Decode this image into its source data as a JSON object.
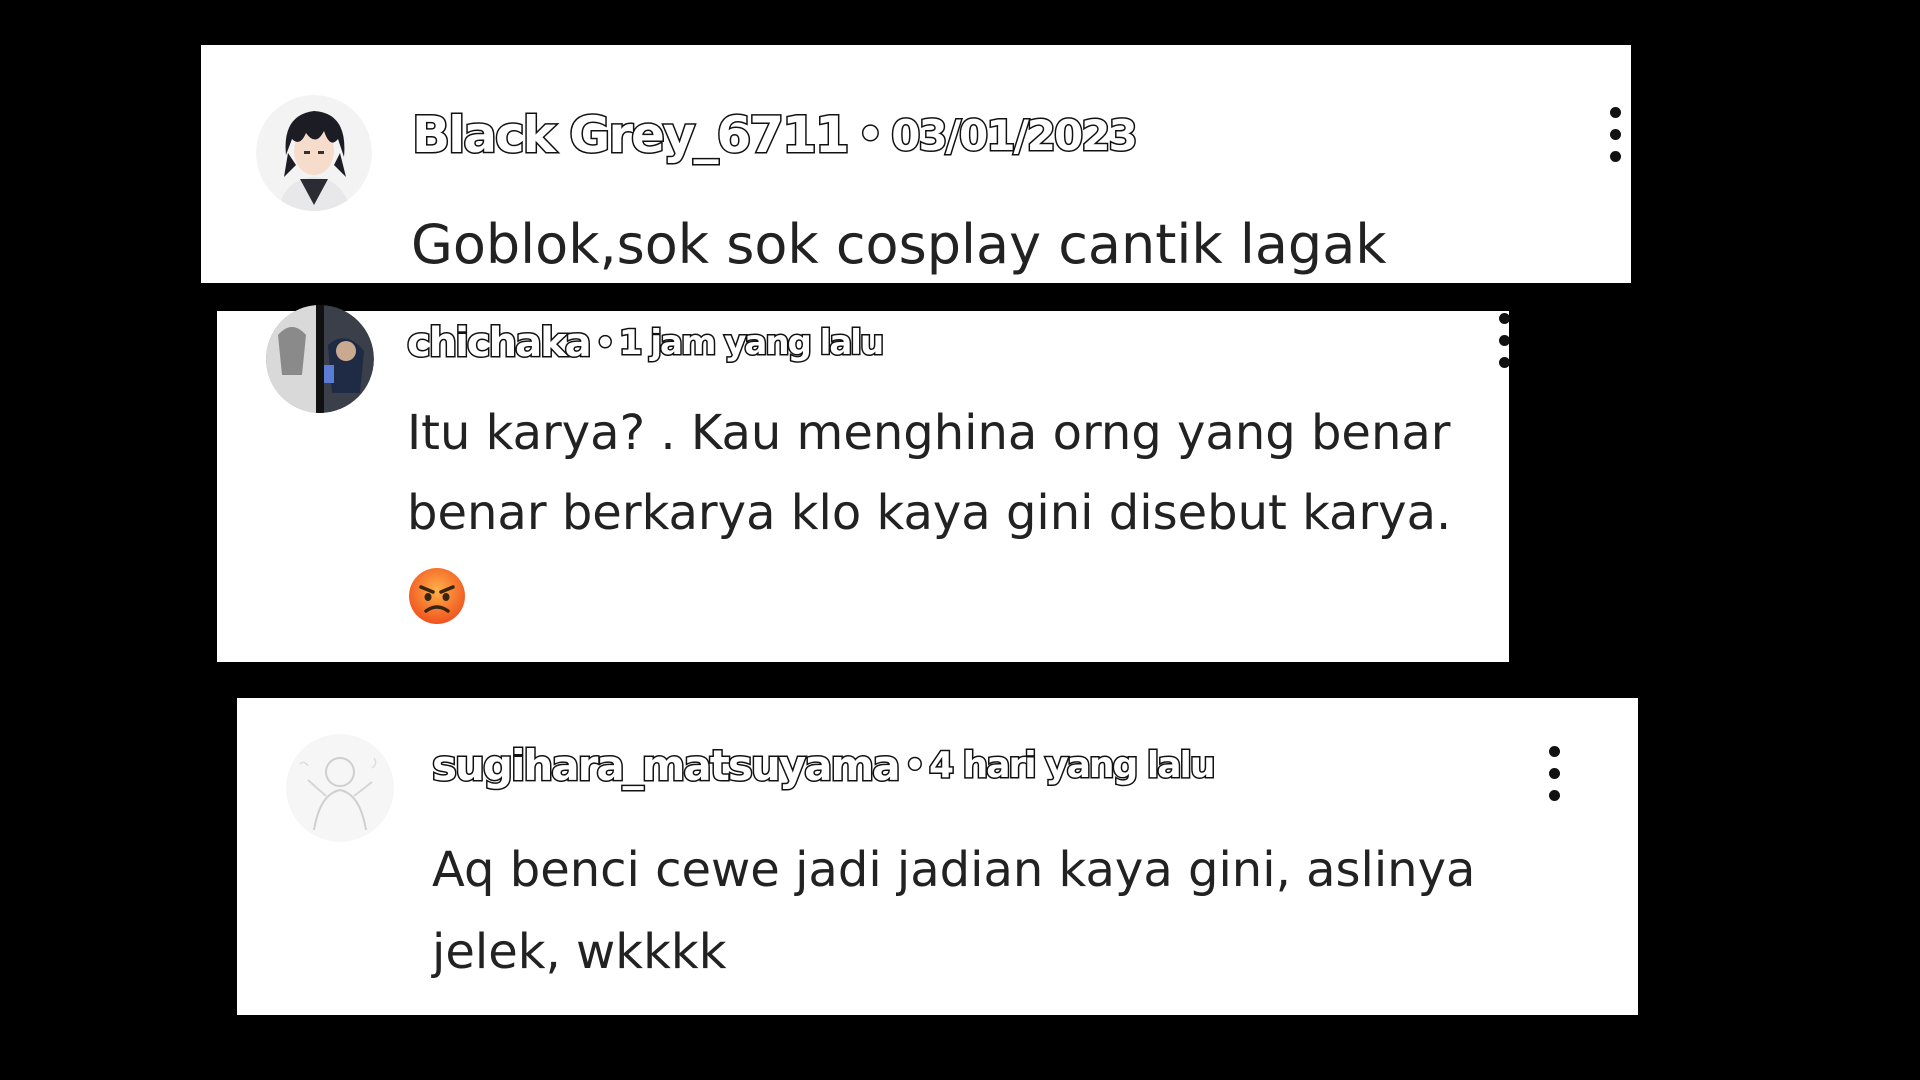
{
  "colors": {
    "background": "#000000",
    "card": "#ffffff",
    "text": "#222222",
    "angry_emoji": "#f4622a"
  },
  "comments": [
    {
      "avatar_icon": "anime-boy-avatar-icon",
      "username": "Black Grey_6711",
      "separator": "•",
      "timestamp": "03/01/2023",
      "body_lines": [
        "Goblok,sok sok cosplay cantik lagak"
      ],
      "menu_icon": "kebab-menu-icon"
    },
    {
      "avatar_icon": "manga-panel-avatar-icon",
      "username": "chichaka",
      "separator": "•",
      "timestamp": "1 jam yang lalu",
      "body_lines": [
        "Itu karya?  . Kau menghina orng yang benar",
        "benar berkarya klo kaya gini disebut karya."
      ],
      "emoji_icon": "angry-face-emoji-icon",
      "menu_icon": "kebab-menu-icon"
    },
    {
      "avatar_icon": "sketch-figure-avatar-icon",
      "username": "sugihara_matsuyama",
      "separator": "•",
      "timestamp": "4 hari yang lalu",
      "body_lines": [
        "Aq benci cewe jadi jadian kaya gini, aslinya",
        "jelek, wkkkk"
      ],
      "menu_icon": "kebab-menu-icon"
    }
  ]
}
